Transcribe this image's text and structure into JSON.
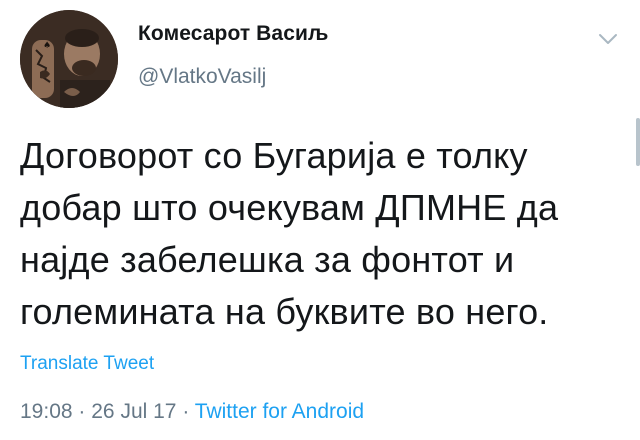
{
  "tweet": {
    "author": {
      "display_name": "Комесарот Васиљ",
      "handle": "@VlatkoVasilj"
    },
    "text": "Договорот со Бугарија е толку\nдобар што очекувам ДПМНЕ да\nнајде забелешка за фонтот и\nголемината на буквите во него.",
    "translate_label": "Translate Tweet",
    "meta": {
      "time": "19:08",
      "separator": "·",
      "date": "26 Jul 17",
      "source": "Twitter for Android"
    }
  },
  "colors": {
    "text": "#14171a",
    "secondary": "#657786",
    "link": "#1da1f2"
  },
  "icons": {
    "menu": "chevron-down-icon"
  }
}
